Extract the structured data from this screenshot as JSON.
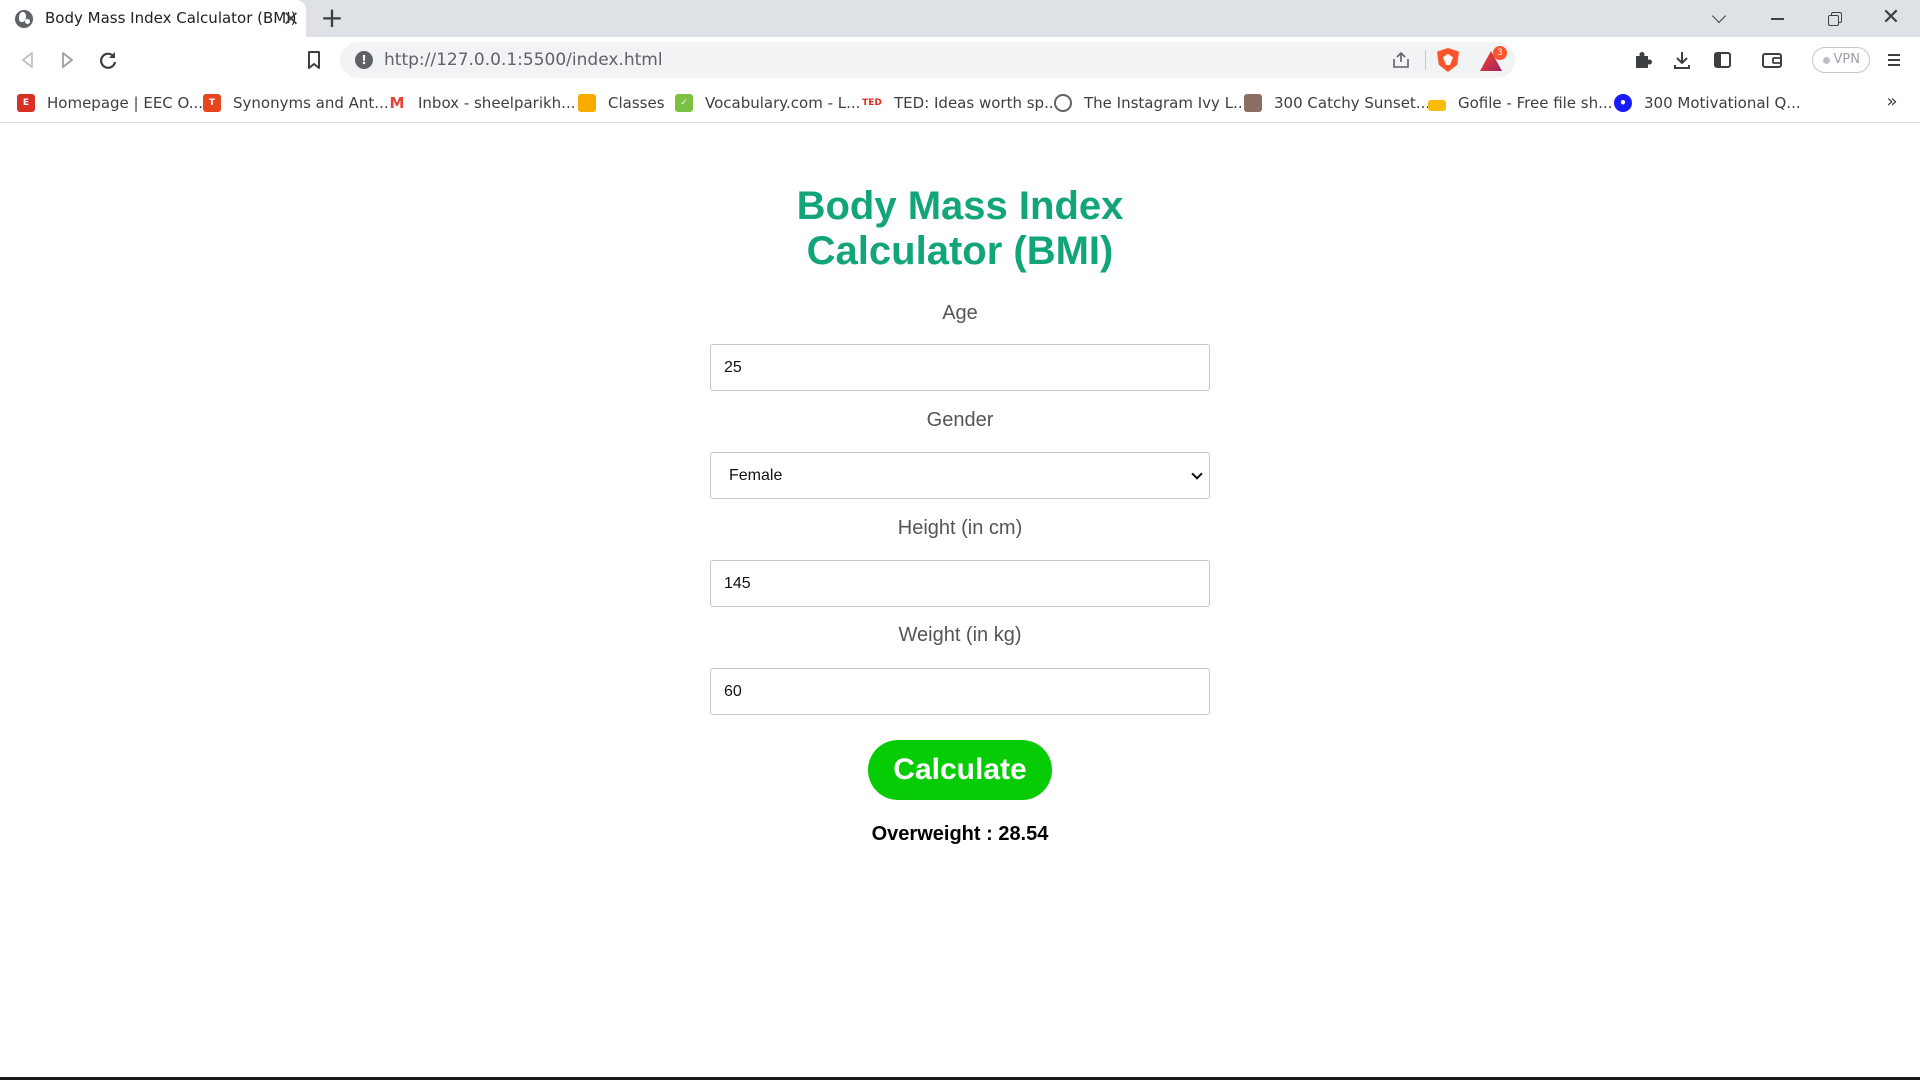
{
  "browser": {
    "tab_title": "Body Mass Index Calculator (BMI)",
    "url": "http://127.0.0.1:5500/index.html",
    "extension_badge": "3",
    "vpn_label": "VPN"
  },
  "bookmarks": [
    {
      "label": "Homepage | EEC O...",
      "icon": "eec-icon",
      "color": "#d93025"
    },
    {
      "label": "Synonyms and Ant...",
      "icon": "thesaurus-icon",
      "color": "#e8451f"
    },
    {
      "label": "Inbox - sheelparikh...",
      "icon": "gmail-icon",
      "color": "#ea4335"
    },
    {
      "label": "Classes",
      "icon": "classroom-icon",
      "color": "#f9ab00"
    },
    {
      "label": "Vocabulary.com - L...",
      "icon": "vocabulary-icon",
      "color": "#7cc242"
    },
    {
      "label": "TED: Ideas worth sp...",
      "icon": "ted-icon",
      "color": "#e62b1e"
    },
    {
      "label": "The Instagram Ivy L...",
      "icon": "ivy-icon",
      "color": "#5f6368"
    },
    {
      "label": "300 Catchy Sunset...",
      "icon": "sunset-icon",
      "color": "#8d6e63"
    },
    {
      "label": "Gofile - Free file sh...",
      "icon": "gofile-icon",
      "color": "#fbbc04"
    },
    {
      "label": "300 Motivational Q...",
      "icon": "motivational-icon",
      "color": "#1a1aff"
    }
  ],
  "page": {
    "heading": "Body Mass Index Calculator (BMI)",
    "age": {
      "label": "Age",
      "value": "25"
    },
    "gender": {
      "label": "Gender",
      "value": "Female"
    },
    "height": {
      "label": "Height (in cm)",
      "value": "145"
    },
    "weight": {
      "label": "Weight (in kg)",
      "value": "60"
    },
    "calculate_label": "Calculate",
    "result": "Overweight : 28.54"
  },
  "colors": {
    "heading": "#13a57a",
    "button": "#06cc06",
    "label": "#555555"
  }
}
